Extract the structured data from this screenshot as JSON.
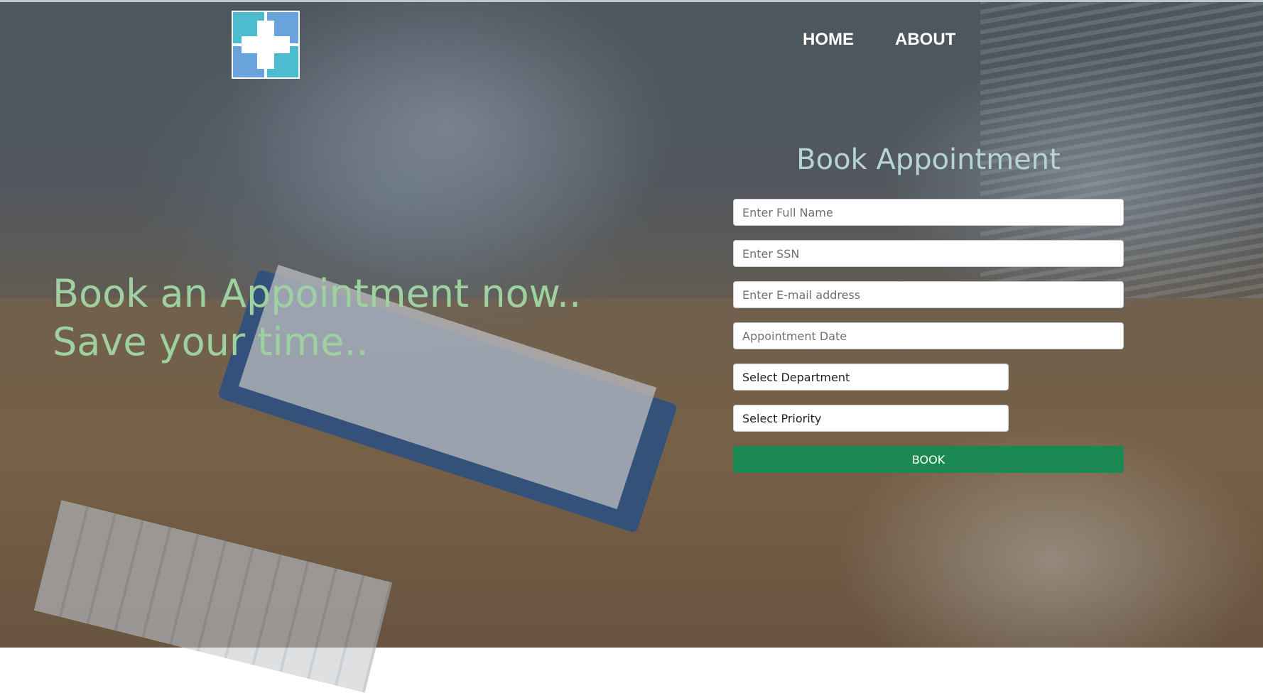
{
  "nav": {
    "home_label": "HOME",
    "about_label": "ABOUT"
  },
  "hero": {
    "line1": "Book an Appointment now..",
    "line2": "Save your time.."
  },
  "form": {
    "title": "Book Appointment",
    "full_name_placeholder": "Enter Full Name",
    "ssn_placeholder": "Enter SSN",
    "email_placeholder": "Enter E-mail address",
    "date_placeholder": "Appointment Date",
    "department_selected": "Select Department",
    "priority_selected": "Select Priority",
    "submit_label": "BOOK"
  },
  "colors": {
    "tagline": "#9fd09f",
    "form_title": "#b7d4d4",
    "book_button": "#1b8a52",
    "logo_teal": "#4dbcd0",
    "logo_blue": "#6aa2dc"
  }
}
